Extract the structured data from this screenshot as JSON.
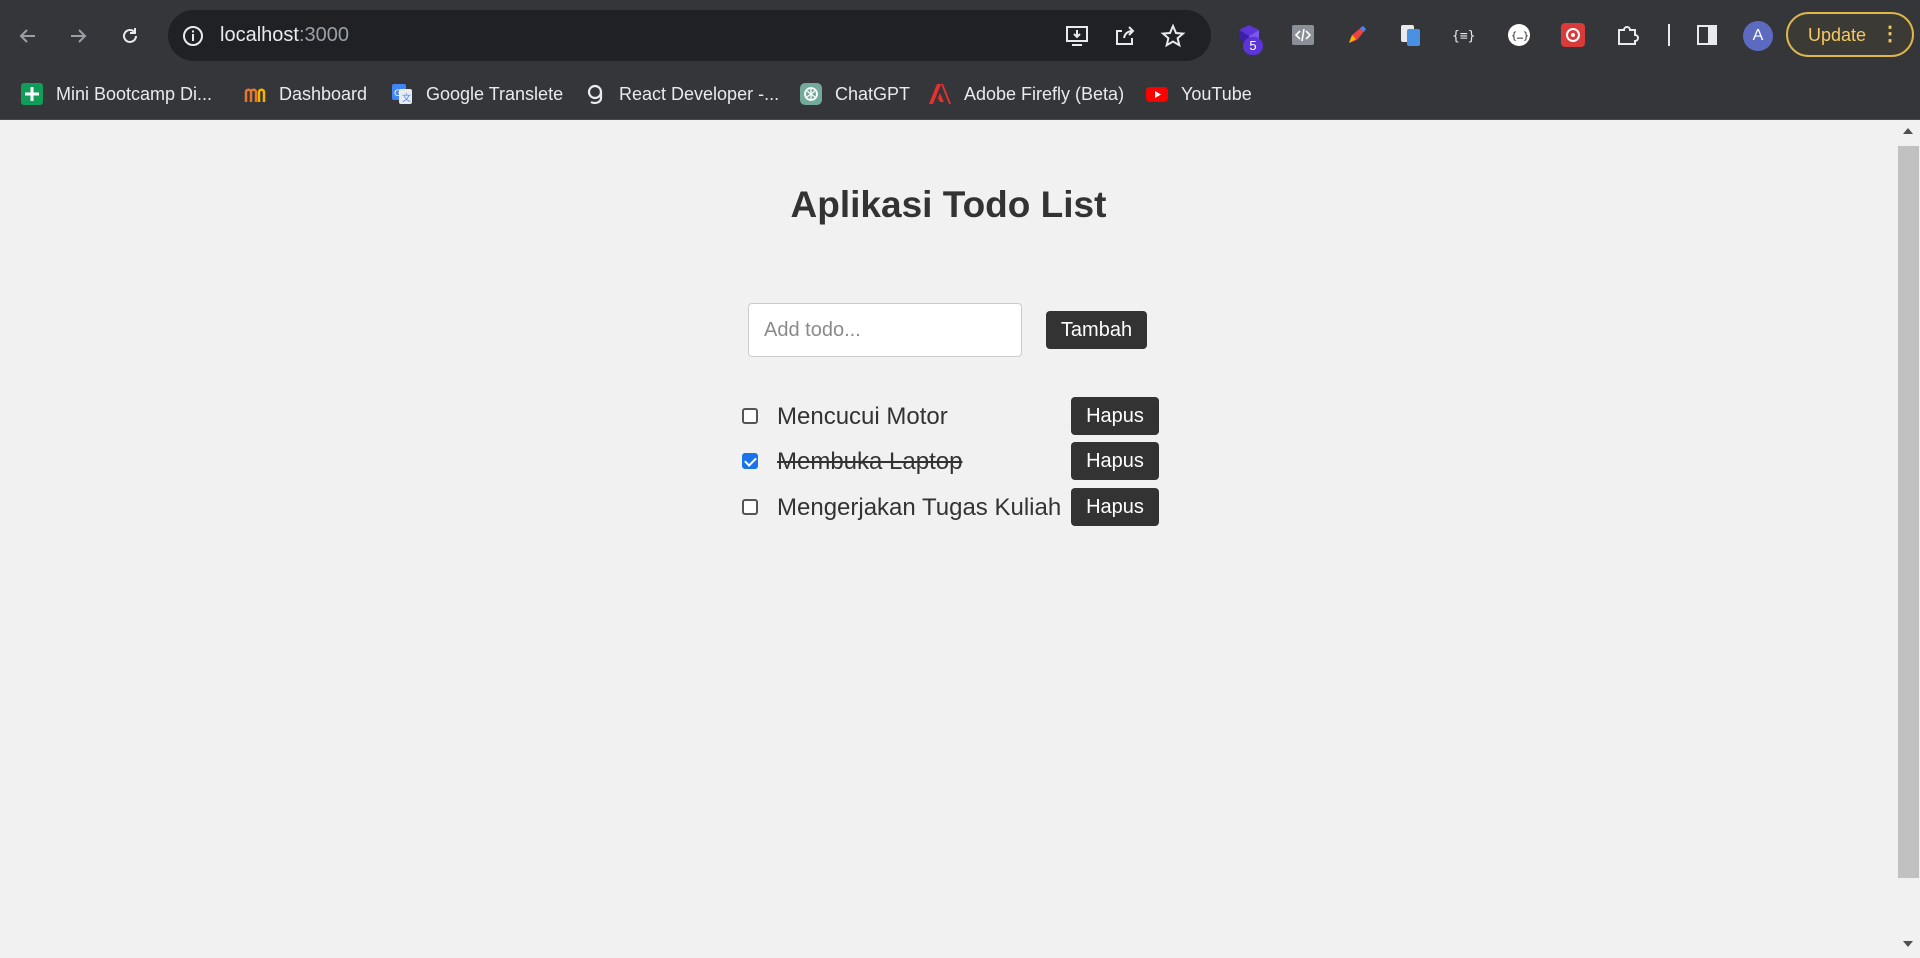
{
  "browser": {
    "url_host": "localhost",
    "url_port": ":3000",
    "extension_badge": "5",
    "avatar_initial": "A",
    "update_label": "Update",
    "update_menu": "⋮"
  },
  "bookmarks": [
    {
      "label": "Mini Bootcamp Di...",
      "icon": "google-sheets-icon"
    },
    {
      "label": "Dashboard",
      "icon": "dashboard-logo-icon"
    },
    {
      "label": "Google Translete",
      "icon": "google-translate-icon"
    },
    {
      "label": "React Developer -...",
      "icon": "react-dev-icon"
    },
    {
      "label": "ChatGPT",
      "icon": "chatgpt-icon"
    },
    {
      "label": "Adobe Firefly (Beta)",
      "icon": "adobe-icon"
    },
    {
      "label": "YouTube",
      "icon": "youtube-icon"
    }
  ],
  "app": {
    "title": "Aplikasi Todo List",
    "input_placeholder": "Add todo...",
    "input_value": "",
    "add_label": "Tambah",
    "todos": [
      {
        "text": "Mencucui Motor",
        "done": false,
        "delete_label": "Hapus"
      },
      {
        "text": "Membuka Laptop",
        "done": true,
        "delete_label": "Hapus"
      },
      {
        "text": "Mengerjakan Tugas Kuliah",
        "done": false,
        "delete_label": "Hapus"
      }
    ]
  },
  "colors": {
    "chrome_bg": "#35363a",
    "omnibox_bg": "#202124",
    "page_bg": "#f1f1f1",
    "button_dark": "#333333",
    "checkbox_accent": "#1a73e8",
    "update_accent": "#f5c963"
  }
}
